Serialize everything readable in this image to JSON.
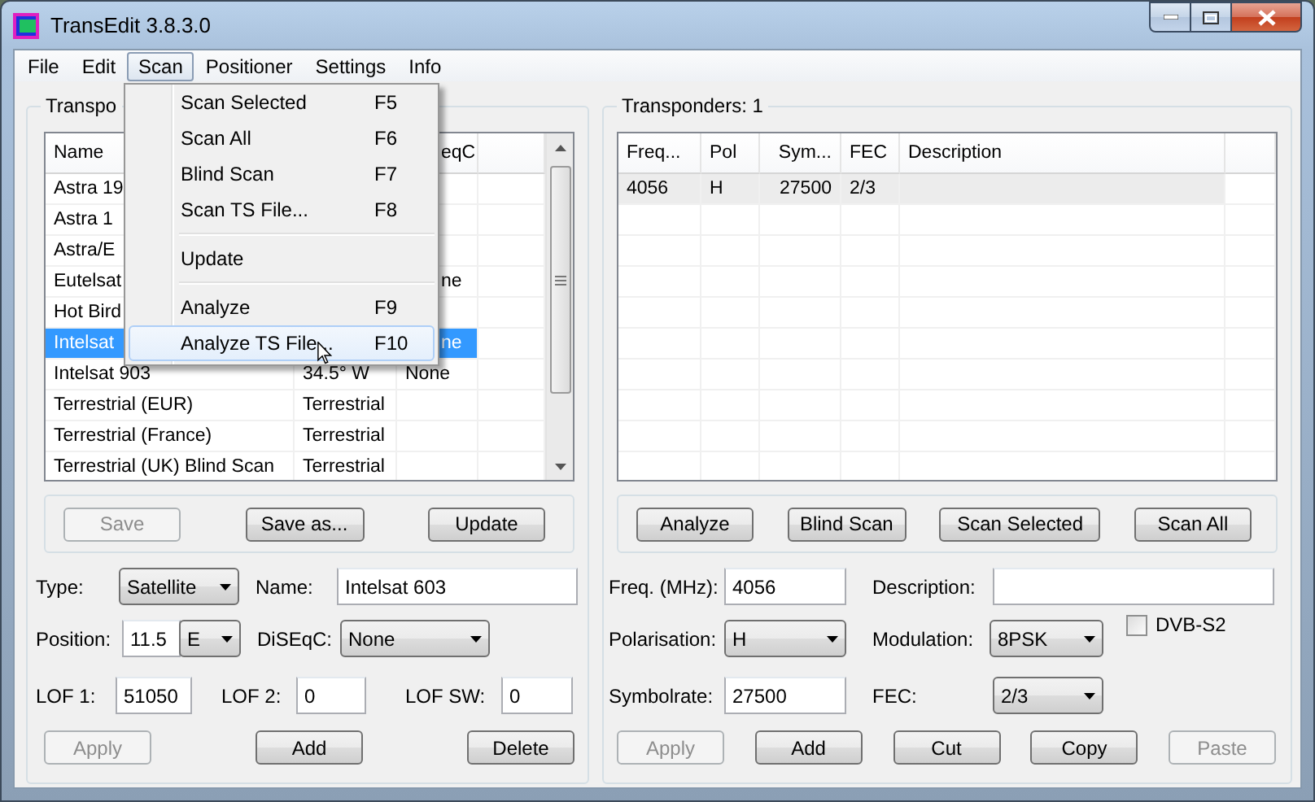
{
  "window": {
    "title": "TransEdit 3.8.3.0"
  },
  "menu_bar": [
    {
      "label": "File",
      "selected": false
    },
    {
      "label": "Edit",
      "selected": false
    },
    {
      "label": "Scan",
      "selected": true
    },
    {
      "label": "Positioner",
      "selected": false
    },
    {
      "label": "Settings",
      "selected": false
    },
    {
      "label": "Info",
      "selected": false
    }
  ],
  "scan_menu": [
    {
      "kind": "item",
      "label": "Scan Selected",
      "shortcut": "F5",
      "selected": false
    },
    {
      "kind": "item",
      "label": "Scan All",
      "shortcut": "F6",
      "selected": false
    },
    {
      "kind": "item",
      "label": "Blind Scan",
      "shortcut": "F7",
      "selected": false
    },
    {
      "kind": "item",
      "label": "Scan TS File...",
      "shortcut": "F8",
      "selected": false
    },
    {
      "kind": "separator"
    },
    {
      "kind": "item",
      "label": "Update",
      "selected": false
    },
    {
      "kind": "separator"
    },
    {
      "kind": "item",
      "label": "Analyze",
      "shortcut": "F9",
      "selected": false
    },
    {
      "kind": "item",
      "label": "Analyze TS File...",
      "shortcut": "F10",
      "selected": true
    }
  ],
  "left_panel": {
    "legend": "Transpo",
    "list": {
      "header": {
        "column_1": "Name",
        "column_3": "eqC"
      },
      "rows": [
        {
          "column_1": "Astra 19",
          "selected": false
        },
        {
          "column_1": "Astra 1",
          "selected": false
        },
        {
          "column_1": "Astra/E",
          "selected": false
        },
        {
          "column_1": "Eutelsat",
          "column_3": "ne",
          "selected": false
        },
        {
          "column_1": "Hot Bird",
          "selected": false
        },
        {
          "column_1": "Intelsat",
          "column_3": "ne",
          "selected": true
        },
        {
          "column_1": "Intelsat 903",
          "column_2": "34.5° W",
          "column_3": "None",
          "selected": false
        },
        {
          "column_1": "Terrestrial (EUR)",
          "column_2": "Terrestrial",
          "selected": false
        },
        {
          "column_1": "Terrestrial (France)",
          "column_2": "Terrestrial",
          "selected": false
        },
        {
          "column_1": "Terrestrial (UK) Blind Scan",
          "column_2": "Terrestrial",
          "selected": false
        }
      ]
    },
    "actions": [
      {
        "label": "Save",
        "disabled": true
      },
      {
        "label": "Save as...",
        "disabled": false
      },
      {
        "label": "Update",
        "disabled": false
      }
    ],
    "form": [
      [
        {
          "kind": "select",
          "label": "Type:",
          "value": "Satellite"
        },
        {
          "kind": "input",
          "label": "Name:",
          "value": "Intelsat 603"
        }
      ],
      [
        {
          "kind": "input_select",
          "label": "Position:",
          "value": "11.5",
          "unit": "E"
        },
        {
          "kind": "select",
          "label": "DiSEqC:",
          "value": "None"
        }
      ],
      [
        {
          "kind": "input",
          "label": "LOF 1:",
          "value": "51050"
        },
        {
          "kind": "input",
          "label": "LOF 2:",
          "value": "0"
        },
        {
          "kind": "input",
          "label": "LOF SW:",
          "value": "0"
        }
      ]
    ],
    "buttons": [
      {
        "label": "Apply",
        "disabled": true
      },
      {
        "label": "Add",
        "disabled": false
      },
      {
        "label": "Delete",
        "disabled": false
      }
    ]
  },
  "right_panel": {
    "legend": "Transponders: 1",
    "list": {
      "header": {
        "column_1": "Freq...",
        "column_2": "Pol",
        "column_3": "Sym...",
        "column_4": "FEC",
        "column_5": "Description"
      },
      "rows": [
        {
          "column_1": "4056",
          "column_2": "H",
          "column_3": "27500",
          "column_4": "2/3",
          "selected": true
        }
      ]
    },
    "actions": [
      {
        "label": "Analyze",
        "disabled": false
      },
      {
        "label": "Blind Scan",
        "disabled": false
      },
      {
        "label": "Scan Selected",
        "disabled": false
      },
      {
        "label": "Scan All",
        "disabled": false
      }
    ],
    "form": [
      [
        {
          "kind": "input",
          "label": "Freq. (MHz):",
          "value": "4056"
        },
        {
          "kind": "input",
          "label": "Description:"
        }
      ],
      [
        {
          "kind": "select",
          "label": "Polarisation:",
          "value": "H"
        },
        {
          "kind": "select",
          "label": "Modulation:",
          "value": "8PSK"
        },
        {
          "kind": "checkbox",
          "label": "DVB-S2",
          "checked": false
        }
      ],
      [
        {
          "kind": "input",
          "label": "Symbolrate:",
          "value": "27500"
        },
        {
          "kind": "select",
          "label": "FEC:",
          "value": "2/3"
        }
      ]
    ],
    "buttons": [
      {
        "label": "Apply",
        "disabled": true
      },
      {
        "label": "Add",
        "disabled": false
      },
      {
        "label": "Cut",
        "disabled": false
      },
      {
        "label": "Copy",
        "disabled": false
      },
      {
        "label": "Paste",
        "disabled": true
      }
    ]
  }
}
